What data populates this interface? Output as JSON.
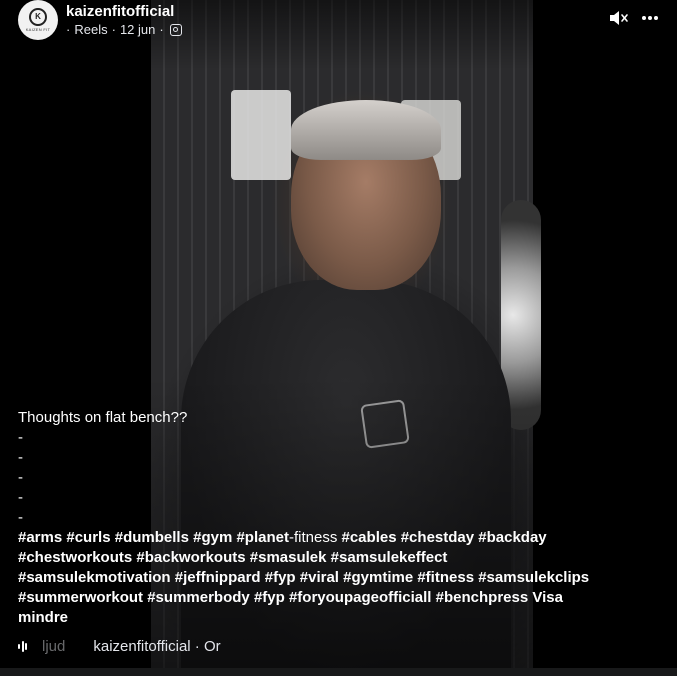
{
  "post": {
    "username": "kaizenfitofficial",
    "meta_prefix": "·",
    "meta_type": "Reels",
    "meta_sep": "·",
    "meta_date": "12 jun",
    "meta_sep2": "·",
    "avatar_text": "KAIZEN FIT"
  },
  "caption": {
    "text_line": "Thoughts on flat bench??",
    "dashes": [
      "-",
      "-",
      "-",
      "-",
      "-"
    ],
    "hashtag_lines": [
      [
        {
          "t": "#arms",
          "tag": true
        },
        {
          "t": " ",
          "tag": false
        },
        {
          "t": "#curls",
          "tag": true
        },
        {
          "t": " ",
          "tag": false
        },
        {
          "t": "#dumbells",
          "tag": true
        },
        {
          "t": " ",
          "tag": false
        },
        {
          "t": "#gym",
          "tag": true
        },
        {
          "t": " ",
          "tag": false
        },
        {
          "t": "#planet",
          "tag": true
        },
        {
          "t": "-fitness ",
          "tag": false
        },
        {
          "t": "#cables",
          "tag": true
        },
        {
          "t": " ",
          "tag": false
        },
        {
          "t": "#chestday",
          "tag": true
        },
        {
          "t": " ",
          "tag": false
        },
        {
          "t": "#backday",
          "tag": true
        }
      ],
      [
        {
          "t": "#chestworkouts",
          "tag": true
        },
        {
          "t": " ",
          "tag": false
        },
        {
          "t": "#backworkouts",
          "tag": true
        },
        {
          "t": " ",
          "tag": false
        },
        {
          "t": "#smasulek",
          "tag": true
        },
        {
          "t": " ",
          "tag": false
        },
        {
          "t": "#samsulekeffect",
          "tag": true
        }
      ],
      [
        {
          "t": "#samsulekmotivation",
          "tag": true
        },
        {
          "t": " ",
          "tag": false
        },
        {
          "t": "#jeffnippard",
          "tag": true
        },
        {
          "t": " ",
          "tag": false
        },
        {
          "t": "#fyp",
          "tag": true
        },
        {
          "t": " ",
          "tag": false
        },
        {
          "t": "#viral",
          "tag": true
        },
        {
          "t": " ",
          "tag": false
        },
        {
          "t": "#gymtime",
          "tag": true
        },
        {
          "t": " ",
          "tag": false
        },
        {
          "t": "#fitness",
          "tag": true
        },
        {
          "t": " ",
          "tag": false
        },
        {
          "t": "#samsulekclips",
          "tag": true
        }
      ],
      [
        {
          "t": "#summerworkout",
          "tag": true
        },
        {
          "t": " ",
          "tag": false
        },
        {
          "t": "#summerbody",
          "tag": true
        },
        {
          "t": " ",
          "tag": false
        },
        {
          "t": "#fyp",
          "tag": true
        },
        {
          "t": " ",
          "tag": false
        },
        {
          "t": "#foryoupageofficiall",
          "tag": true
        },
        {
          "t": " ",
          "tag": false
        },
        {
          "t": "#benchpress",
          "tag": true
        },
        {
          "t": " ",
          "tag": false
        },
        {
          "t": "Visa",
          "tag": true
        }
      ],
      [
        {
          "t": "mindre",
          "tag": true
        }
      ]
    ]
  },
  "audio": {
    "label_faded": "ljud",
    "label": "kaizenfitofficial · Or"
  },
  "icons": {
    "mute": "speaker-muted-icon",
    "more": "more-horizontal-icon",
    "audio": "audio-waveform-icon",
    "instagram": "instagram-icon"
  },
  "colors": {
    "background": "#000000",
    "text": "#ffffff",
    "meta_text": "#e4e6eb"
  }
}
